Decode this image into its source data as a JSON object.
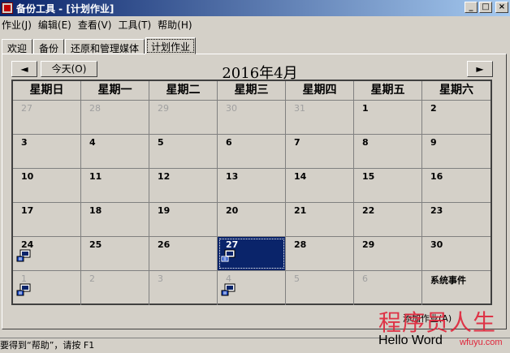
{
  "window": {
    "title": "备份工具 - [计划作业]",
    "min": "_",
    "max": "□",
    "close": "×"
  },
  "menu": [
    "作业(J)",
    "编辑(E)",
    "查看(V)",
    "工具(T)",
    "帮助(H)"
  ],
  "tabs": [
    "欢迎",
    "备份",
    "还原和管理媒体",
    "计划作业"
  ],
  "nav": {
    "prev": "◄",
    "today": "今天(O)",
    "next": "►"
  },
  "month_title": "2016年4月",
  "weekdays": [
    "星期日",
    "星期一",
    "星期二",
    "星期三",
    "星期四",
    "星期五",
    "星期六"
  ],
  "weeks": [
    [
      "27",
      "28",
      "29",
      "30",
      "31",
      "1",
      "2"
    ],
    [
      "3",
      "4",
      "5",
      "6",
      "7",
      "8",
      "9"
    ],
    [
      "10",
      "11",
      "12",
      "13",
      "14",
      "15",
      "16"
    ],
    [
      "17",
      "18",
      "19",
      "20",
      "21",
      "22",
      "23"
    ],
    [
      "24",
      "25",
      "26",
      "27",
      "28",
      "29",
      "30"
    ],
    [
      "1",
      "2",
      "3",
      "4",
      "5",
      "6",
      "系统事件"
    ]
  ],
  "add_task": "添加作业(A)",
  "status": "要得到“帮助”，请按 F1",
  "watermark": {
    "cn": "程序员人生",
    "en": "Hello Word",
    "site": "wfuyu.com"
  }
}
